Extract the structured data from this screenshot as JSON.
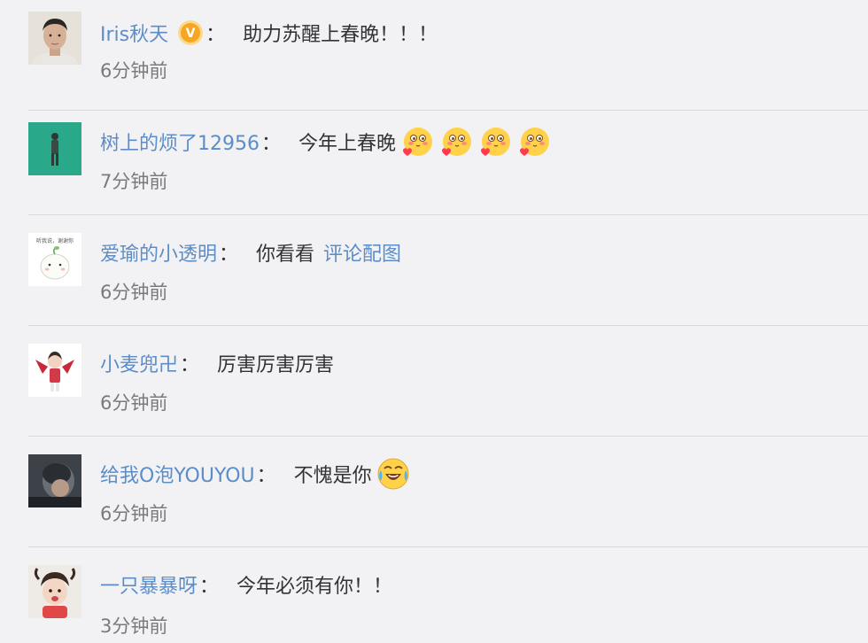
{
  "comments": [
    {
      "username": "Iris秋天",
      "colon": "：",
      "text": "助力苏醒上春晚！！！",
      "time": "6分钟前",
      "verified_badge": "v-verified-icon",
      "badge_letter": "V"
    },
    {
      "username": "树上的烦了12956",
      "colon": "：",
      "text": "今年上春晚",
      "time": "7分钟前",
      "emoji": "heart-blush-emoji",
      "emoji_count": 4
    },
    {
      "username": "爱瑜的小透明",
      "colon": "：",
      "text": "你看看",
      "link": "评论配图",
      "time": "6分钟前",
      "avatar_caption": "听我说，谢谢你"
    },
    {
      "username": "小麦兜卍",
      "colon": "：",
      "text": "厉害厉害厉害",
      "time": "6分钟前"
    },
    {
      "username": "给我O泡YOUYOU",
      "colon": "：",
      "text": "不愧是你",
      "time": "6分钟前",
      "emoji": "laugh-cry-emoji"
    },
    {
      "username": "一只暴暴呀",
      "colon": "：",
      "text": "今年必须有你！！",
      "time": "3分钟前"
    }
  ],
  "colors": {
    "background": "#f2f2f5",
    "username": "#5b8dc9",
    "text": "#333333",
    "time": "#7a7a7a",
    "badge": "#f5a623"
  }
}
